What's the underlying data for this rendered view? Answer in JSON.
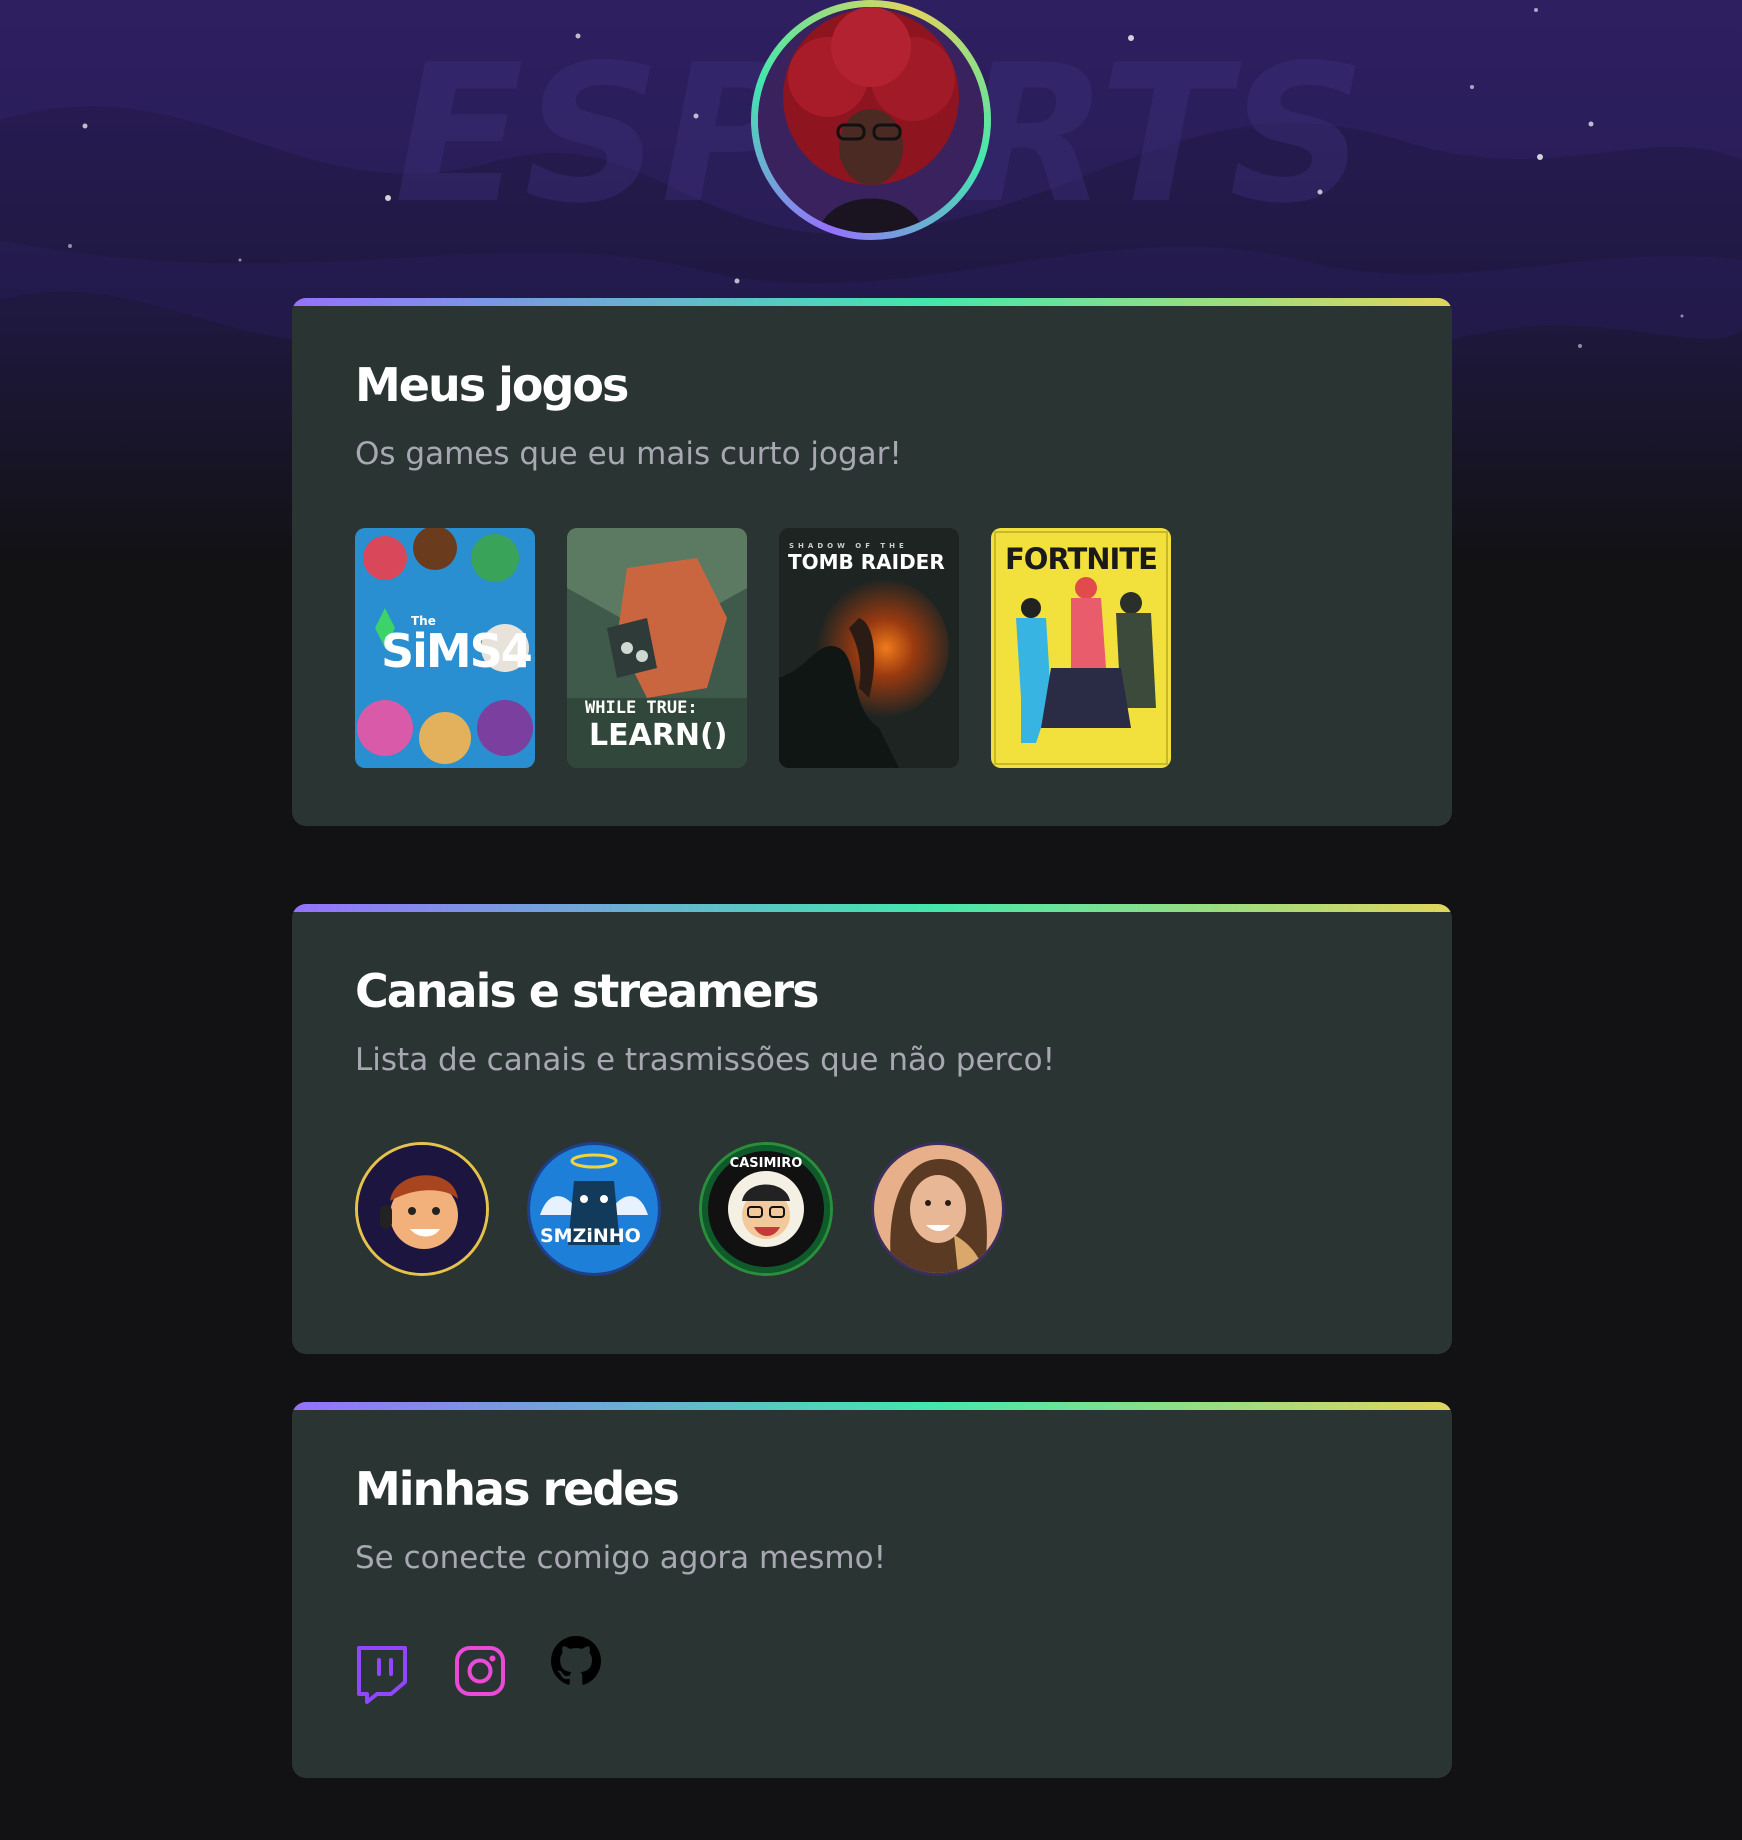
{
  "profile": {
    "avatar_alt": "Foto de perfil"
  },
  "sections": {
    "games": {
      "title": "Meus jogos",
      "subtitle": "Os games que eu mais curto jogar!",
      "items": [
        {
          "name": "The Sims 4",
          "cover_text": "SiMS4",
          "cover_small": "The",
          "bg": "#2a8fd0"
        },
        {
          "name": "while True: learn()",
          "cover_text": "LEARN()",
          "cover_small": "WHILE TRUE:",
          "bg": "#3f5a4a"
        },
        {
          "name": "Shadow of the Tomb Raider",
          "cover_text": "TOMB RAIDER",
          "cover_small": "SHADOW OF THE",
          "bg": "#1d2422"
        },
        {
          "name": "Fortnite",
          "cover_text": "FORTNITE",
          "cover_small": "",
          "bg": "#f2e13c"
        }
      ]
    },
    "streamers": {
      "title": "Canais e streamers",
      "subtitle": "Lista de canais e trasmissões que não perco!",
      "items": [
        {
          "name": "streamer-1",
          "text": ""
        },
        {
          "name": "smzinho",
          "text": "SMZiNHO"
        },
        {
          "name": "casimiro",
          "text": "CASIMIRO"
        },
        {
          "name": "streamer-4",
          "text": ""
        }
      ]
    },
    "socials": {
      "title": "Minhas redes",
      "subtitle": "Se conecte comigo agora mesmo!",
      "items": [
        {
          "name": "twitch-icon",
          "color": "#9146ff"
        },
        {
          "name": "instagram-icon",
          "color": "#e94ad6"
        },
        {
          "name": "github-icon",
          "color": "#000000"
        }
      ]
    }
  },
  "colors": {
    "background": "#121214",
    "card": "#2a3433",
    "subtitle": "#a8a8b3",
    "gradient": [
      "#9572fc",
      "#43e7ad",
      "#e1d55d"
    ]
  }
}
